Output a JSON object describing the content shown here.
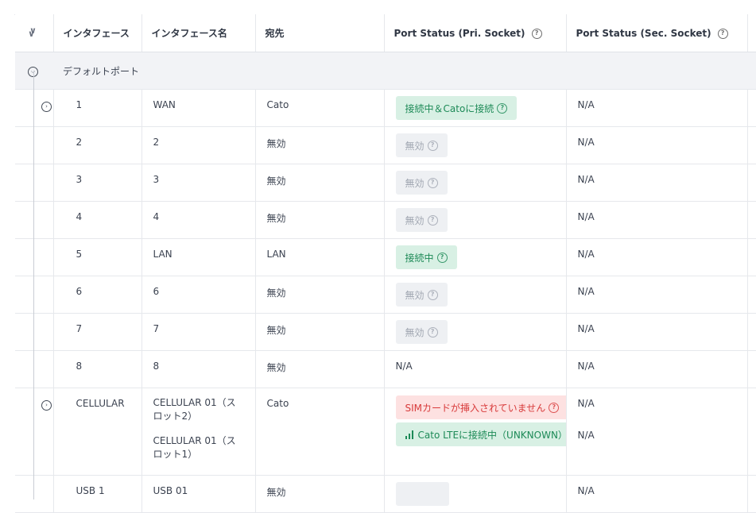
{
  "columns": [
    "インタフェース",
    "インタフェース名",
    "宛先",
    "Port Status (Pri. Socket)",
    "Port Status (Sec. Socket)"
  ],
  "group_label": "デフォルトポート",
  "rows": [
    {
      "id": "1",
      "name": "WAN",
      "dest": "Cato",
      "pri": "接続中＆Catoに接続",
      "pri_type": "green",
      "sec": "N/A",
      "expandable": true
    },
    {
      "id": "2",
      "name": "2",
      "dest": "無効",
      "pri": "無効",
      "pri_type": "grey",
      "sec": "N/A",
      "expandable": false
    },
    {
      "id": "3",
      "name": "3",
      "dest": "無効",
      "pri": "無効",
      "pri_type": "grey",
      "sec": "N/A",
      "expandable": false
    },
    {
      "id": "4",
      "name": "4",
      "dest": "無効",
      "pri": "無効",
      "pri_type": "grey",
      "sec": "N/A",
      "expandable": false
    },
    {
      "id": "5",
      "name": "LAN",
      "dest": "LAN",
      "pri": "接続中",
      "pri_type": "green",
      "sec": "N/A",
      "expandable": false
    },
    {
      "id": "6",
      "name": "6",
      "dest": "無効",
      "pri": "無効",
      "pri_type": "grey",
      "sec": "N/A",
      "expandable": false
    },
    {
      "id": "7",
      "name": "7",
      "dest": "無効",
      "pri": "無効",
      "pri_type": "grey",
      "sec": "N/A",
      "expandable": false
    },
    {
      "id": "8",
      "name": "8",
      "dest": "無効",
      "pri": "N/A",
      "pri_type": "text",
      "sec": "N/A",
      "expandable": false
    }
  ],
  "cellular": {
    "id": "CELLULAR",
    "name1": "CELLULAR 01（スロット2）",
    "name2": "CELLULAR 01（スロット1）",
    "dest": "Cato",
    "pri1": "SIMカードが挿入されていません",
    "pri2": "Cato LTEに接続中（UNKNOWN）",
    "sec1": "N/A",
    "sec2": "N/A"
  },
  "usb": {
    "id": "USB 1",
    "name": "USB 01",
    "dest": "無効",
    "sec": "N/A"
  },
  "icons": {
    "collapse_all": "double-chevron-down-icon",
    "help": "question-circle-icon",
    "expand": "chevron-circle-icon",
    "signal": "signal-bars-icon"
  },
  "colors": {
    "green_bg": "#d8f0e4",
    "green_text": "#1d8a57",
    "grey_bg": "#eef0f3",
    "grey_text": "#a0a6b1",
    "red_bg": "#fde1e1",
    "red_text": "#d83b3b",
    "group_bg": "#f2f3f6"
  }
}
